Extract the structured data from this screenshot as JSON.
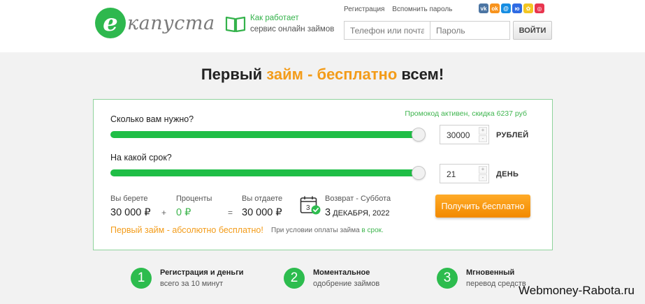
{
  "header": {
    "logo_letter": "е",
    "logo_text": "капуста",
    "how_it_works_line1": "Как работает",
    "how_it_works_line2": "сервис онлайн займов",
    "register_link": "Регистрация",
    "forgot_link": "Вспомнить пароль",
    "socials": [
      {
        "label": "vk",
        "color": "#4c75a3"
      },
      {
        "label": "ok",
        "color": "#f7931e"
      },
      {
        "label": "@",
        "color": "#168de2"
      },
      {
        "label": "ю",
        "color": "#2f6be3"
      },
      {
        "label": "✿",
        "color": "#f3c623"
      },
      {
        "label": "◎",
        "color": "#e8364f"
      }
    ],
    "phone_placeholder": "Телефон или почта",
    "password_placeholder": "Пароль",
    "login_button": "ВОЙТИ"
  },
  "hero": {
    "part1": "Первый ",
    "accent": "займ - бесплатно",
    "part2": " всем!"
  },
  "calculator": {
    "promo": "Промокод активен, скидка 6237 руб",
    "amount_question": "Сколько вам нужно?",
    "amount_value": "30000",
    "amount_unit": "РУБЛЕЙ",
    "amount_fraction": 1.0,
    "term_question": "На какой срок?",
    "term_value": "21",
    "term_unit": "ДЕНЬ",
    "term_fraction": 1.0,
    "stepper_up": "+",
    "stepper_down": "-",
    "take_label": "Вы берете",
    "take_value": "30 000 ₽",
    "plus": "+",
    "interest_label": "Проценты",
    "interest_value": "0 ₽",
    "equals": "=",
    "give_label": "Вы отдаете",
    "give_value": "30 000 ₽",
    "calendar_day": "3",
    "return_label": "Возврат - Суббота",
    "return_day": "3",
    "return_rest": " ДЕКАБРЯ, 2022",
    "get_button": "Получить бесплатно",
    "free_text": "Первый займ - абсолютно бесплатно!",
    "note_text": "При условии оплаты займа ",
    "note_green": "в срок."
  },
  "steps": [
    {
      "num": "1",
      "title": "Регистрация и деньги",
      "desc": "всего за 10 минут"
    },
    {
      "num": "2",
      "title": "Моментальное",
      "desc": "одобрение займов"
    },
    {
      "num": "3",
      "title": "Мгновенный",
      "desc": "перевод средств"
    }
  ],
  "watermark": "Webmoney-Rabota.ru"
}
